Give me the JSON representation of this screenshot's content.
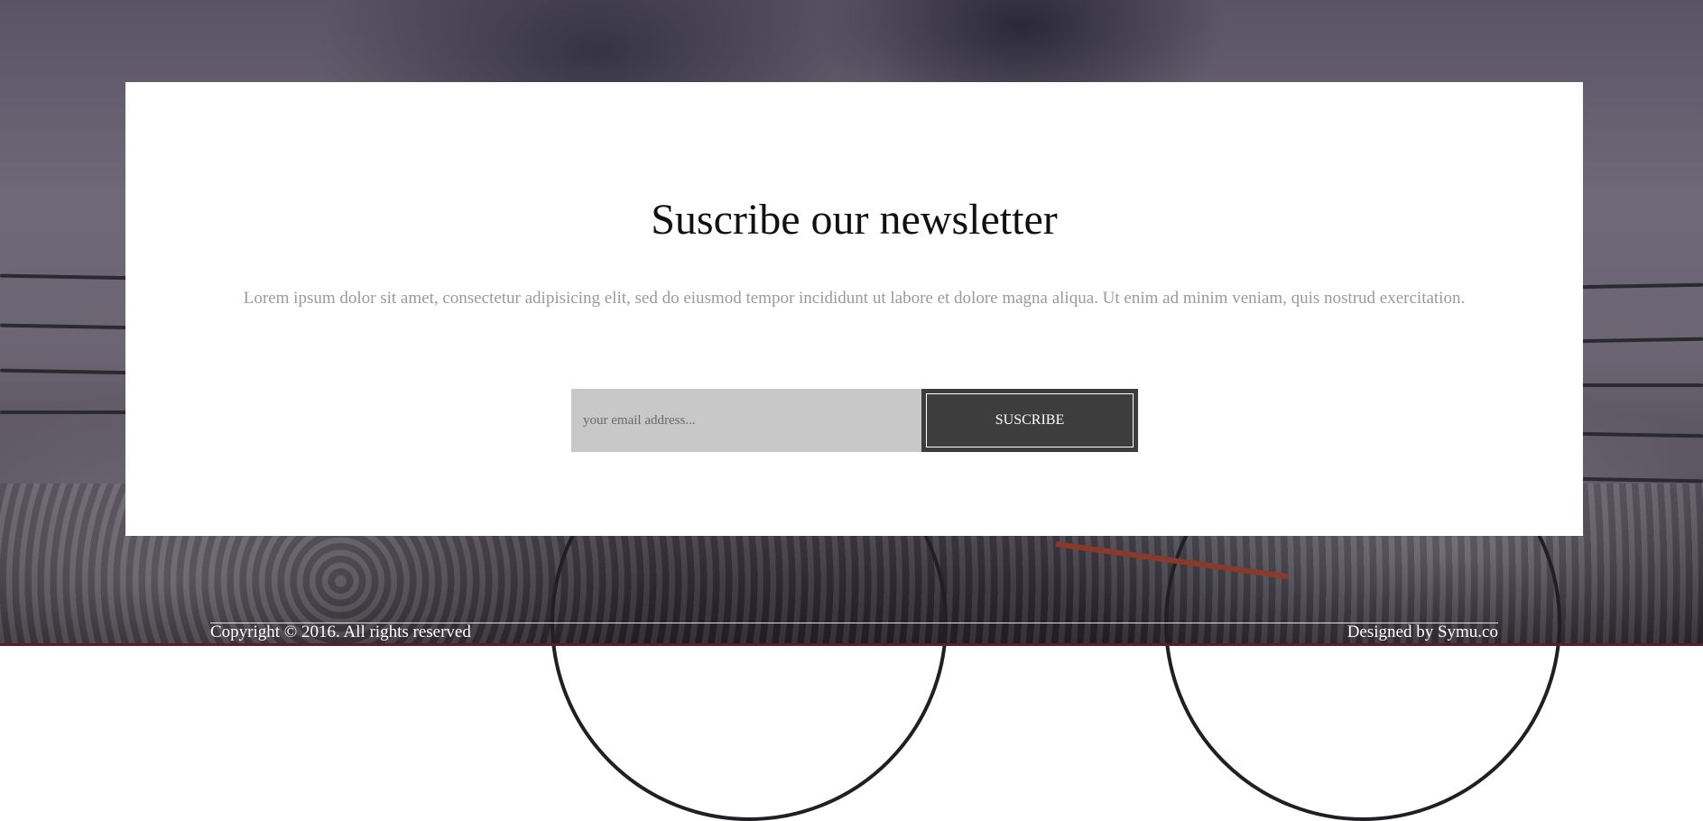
{
  "newsletter": {
    "title": "Suscribe our newsletter",
    "description": "Lorem ipsum dolor sit amet, consectetur adipisicing elit, sed do eiusmod tempor incididunt ut labore et dolore magna aliqua. Ut enim ad minim veniam, quis nostrud exercitation.",
    "email_placeholder": "your email address...",
    "email_value": "",
    "button_label": "SUSCRIBE"
  },
  "footer": {
    "copyright": "Copyright © 2016. All rights reserved",
    "credit": "Designed by Symu.co"
  },
  "colors": {
    "card_bg": "#ffffff",
    "button_bg": "#3d3d3d",
    "input_bg": "#c8c8c8",
    "description_text": "#9a9a9a",
    "bottom_strip": "#5a1e2a"
  }
}
